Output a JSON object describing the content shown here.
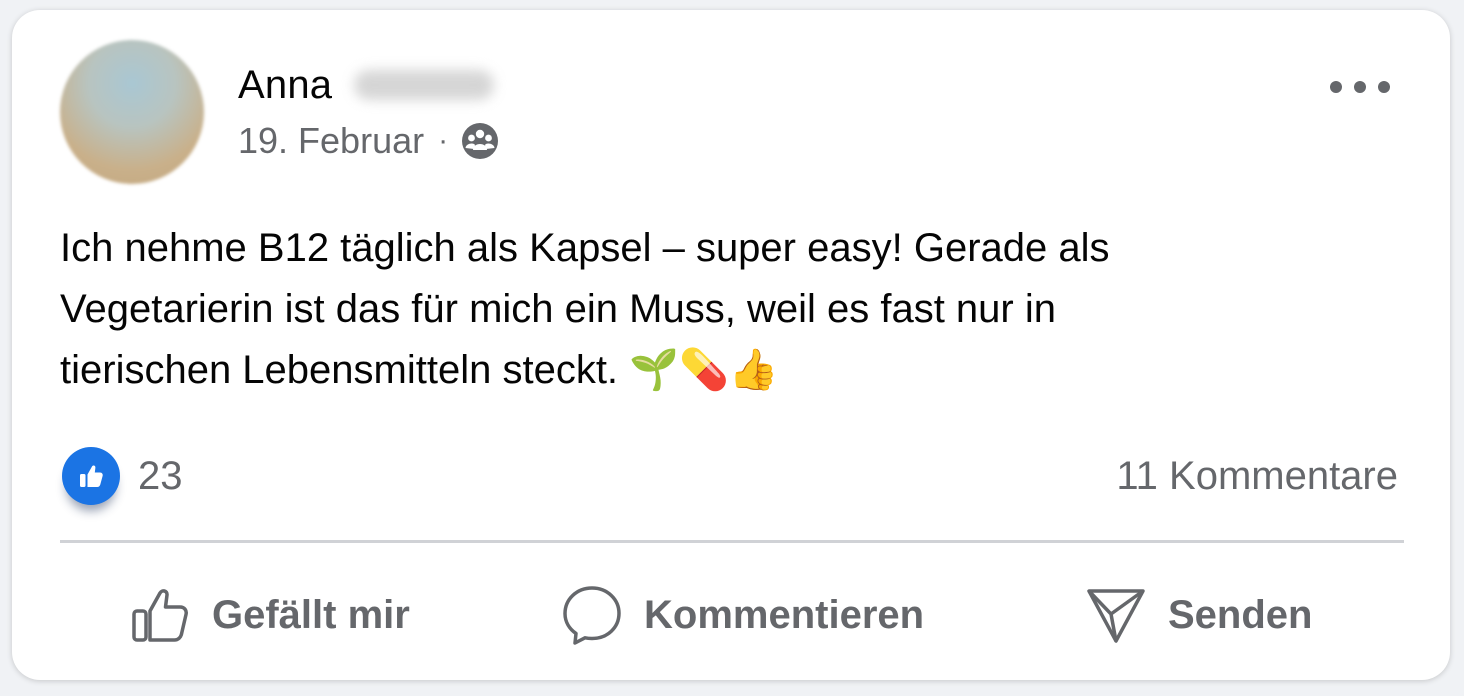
{
  "post": {
    "author_first_name": "Anna",
    "date": "19. Februar",
    "separator": "·",
    "audience_icon": "friends-group-icon",
    "text": "Ich nehme B12 täglich als Kapsel – super easy! Gerade als\nVegetarierin ist das für mich ein Muss, weil es fast nur in\ntierischen Lebensmitteln steckt. 🌱💊👍"
  },
  "reactions": {
    "like_count": "23",
    "comments_label": "11 Kommentare",
    "like_badge_color": "#1b74e4"
  },
  "actions": {
    "like_label": "Gefällt mir",
    "comment_label": "Kommentieren",
    "send_label": "Senden"
  },
  "colors": {
    "text_primary": "#050505",
    "text_secondary": "#65676b",
    "divider": "#d0d2d6"
  }
}
